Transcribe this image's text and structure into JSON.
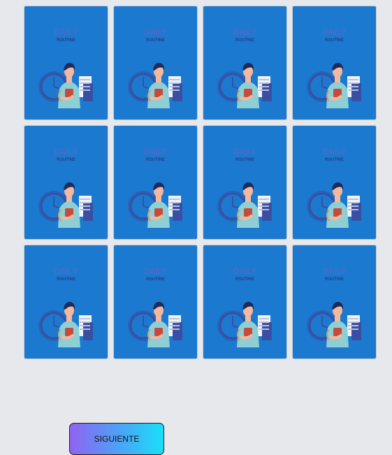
{
  "cards": [
    {
      "title": "DAILY",
      "subtitle": "ROUTINE"
    },
    {
      "title": "DAILY",
      "subtitle": "ROUTINE"
    },
    {
      "title": "DAILY",
      "subtitle": "ROUTINE"
    },
    {
      "title": "DAILY",
      "subtitle": "ROUTINE"
    },
    {
      "title": "DAILY",
      "subtitle": "ROUTINE"
    },
    {
      "title": "DAILY",
      "subtitle": "ROUTINE"
    },
    {
      "title": "DAILY",
      "subtitle": "ROUTINE"
    },
    {
      "title": "DAILY",
      "subtitle": "ROUTINE"
    },
    {
      "title": "DAILY",
      "subtitle": "ROUTINE"
    },
    {
      "title": "DAILY",
      "subtitle": "ROUTINE"
    },
    {
      "title": "DAILY",
      "subtitle": "ROUTINE"
    },
    {
      "title": "DAILY",
      "subtitle": "ROUTINE"
    }
  ],
  "next_button": {
    "label": "SIGUIENTE"
  },
  "colors": {
    "page_background": "#e7e8ec",
    "card_background": "#1b7ad0",
    "button_gradient_start": "#8f63f2",
    "button_gradient_end": "#18e0f8"
  },
  "icons": {
    "card_illustration": "daily-routine-person-with-clock-and-coffee"
  }
}
